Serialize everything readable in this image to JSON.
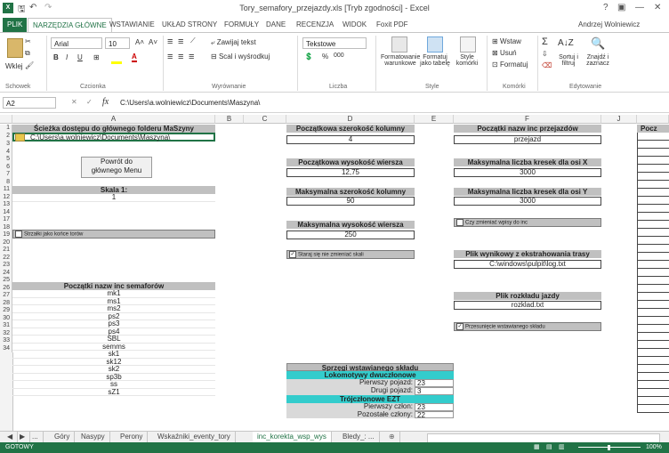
{
  "window": {
    "title": "Tory_semafory_przejazdy.xls [Tryb zgodności] - Excel",
    "help": "?",
    "restore_glyph": "▣",
    "minimize_glyph": "—",
    "close_glyph": "✕",
    "user": "Andrzej Wolniewicz"
  },
  "tabs": [
    "PLIK",
    "NARZĘDZIA GŁÓWNE",
    "WSTAWIANIE",
    "UKŁAD STRONY",
    "FORMUŁY",
    "DANE",
    "RECENZJA",
    "WIDOK",
    "Foxit PDF"
  ],
  "ribbon": {
    "clipboard": {
      "paste": "Wklej",
      "group": "Schowek"
    },
    "font": {
      "name": "Arial",
      "size": "10",
      "bold": "B",
      "italic": "I",
      "underline": "U",
      "group": "Czcionka"
    },
    "alignment": {
      "wrap": "Zawijaj tekst",
      "merge": "Scal i wyśrodkuj",
      "group": "Wyrównanie"
    },
    "number": {
      "format": "Tekstowe",
      "percent": "%",
      "thousands": "000",
      "group": "Liczba"
    },
    "styles": {
      "cond": "Formatowanie warunkowe",
      "table": "Formatuj jako tabelę",
      "cell": "Style komórki",
      "group": "Style"
    },
    "cells": {
      "insert": "Wstaw",
      "delete": "Usuń",
      "format": "Formatuj",
      "group": "Komórki"
    },
    "editing": {
      "sum": "Σ",
      "sort": "Sortuj i filtruj",
      "find": "Znajdź i zaznacz",
      "group": "Edytowanie"
    }
  },
  "formula_bar": {
    "name_box": "A2",
    "fx": "fx",
    "value": "C:\\Users\\a.wolniewicz\\Documents\\Maszyna\\"
  },
  "columns": [
    "A",
    "B",
    "C",
    "D",
    "E",
    "F",
    "J"
  ],
  "rows": [
    "1",
    "2",
    "3",
    "4",
    "5",
    "6",
    "7",
    "8",
    "11",
    "12",
    "13",
    "14",
    "17",
    "18",
    "19",
    "20",
    "21",
    "22",
    "23",
    "24",
    "25",
    "26",
    "27",
    "28",
    "29",
    "30",
    "31",
    "32",
    "33",
    "34"
  ],
  "sheet": {
    "path_header": "Ścieżka dostępu do głównego folderu MaSzyny",
    "path_value": "C:\\Users\\a.wolniewicz\\Documents\\Maszyna\\",
    "menu_button": "Powrót do\ngłównego Menu",
    "scale_header": "Skala 1:",
    "scale_value": "1",
    "arrows_chk": "Strzałki jako końce torów",
    "sem_header": "Początki nazw inc semaforów",
    "semaphores": [
      "mk1",
      "ms1",
      "ms2",
      "ps2",
      "ps3",
      "ps4",
      "SBL",
      "semms",
      "sk1",
      "sk12",
      "sk2",
      "sp3b",
      "ss",
      "sZ1"
    ],
    "col_width_header": "Początkowa szerokość kolumny",
    "col_width_value": "4",
    "row_height_header": "Początkowa wysokość wiersza",
    "row_height_value": "12,75",
    "max_col_header": "Maksymalna szerokość kolumny",
    "max_col_value": "90",
    "max_row_header": "Maksymalna wysokość wiersza",
    "max_row_value": "250",
    "scale_chk": "Staraj się nie zmieniać skali",
    "crossing_header": "Początki nazw inc przejazdów",
    "crossing_value": "przejazd",
    "max_x_header": "Maksymalna liczba kresek dla osi X",
    "max_x_value": "3000",
    "max_y_header": "Maksymalna liczba kresek dla osi Y",
    "max_y_value": "3000",
    "inc_chk": "Czy zmieniać wpisy do inc",
    "output_header": "Plik wynikowy z ekstrahowania trasy",
    "output_value": "C:\\windows\\pulpit\\log.txt",
    "schedule_header": "Plik rozkładu jazdy",
    "schedule_value": "rozklad.txt",
    "shift_chk": "Przesunięcie wstawianego składu",
    "coupling_header": "Sprzęgi wstawianego składu",
    "loco_header": "Lokomotywy dwuczłonowe",
    "first_vehicle": "Pierwszy pojazd:",
    "first_vehicle_val": "23",
    "second_vehicle": "Drugi pojazd:",
    "second_vehicle_val": "3",
    "ezt_header": "Trójczłonowe EZT",
    "first_member": "Pierwszy człon:",
    "first_member_val": "23",
    "rest_members": "Pozostałe człony:",
    "rest_members_val": "22",
    "j_header": "Pocz"
  },
  "sheet_tabs": [
    "...",
    "Góry",
    "Nasypy",
    "Perony",
    "Wskaźniki_eventy_tory",
    "inc_korekta_wsp_wys",
    "Bledy_: ..."
  ],
  "status": {
    "ready": "GOTOWY",
    "zoom": "100%"
  }
}
